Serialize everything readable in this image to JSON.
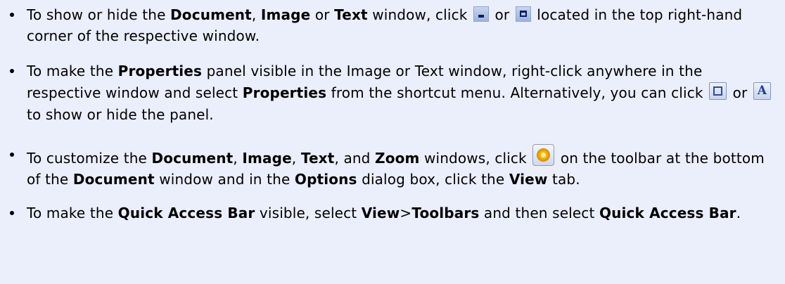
{
  "bullets": [
    {
      "t1": "To show or hide the ",
      "b1": "Document",
      "t2": ", ",
      "b2": "Image",
      "t3": " or ",
      "b3": "Text",
      "t4": " window, click ",
      "icon1": "minimize-icon",
      "t5": " or ",
      "icon2": "maximize-icon",
      "t6": " located in the top right-hand corner of the respective window."
    },
    {
      "t1": "To make the ",
      "b1": "Properties",
      "t2": " panel visible in the Image or Text window, right-click anywhere in the respective window and select ",
      "b2": "Properties",
      "t3": " from the shortcut menu. Alternatively, you can click ",
      "icon1": "image-properties-icon",
      "t4": " or ",
      "icon2": "text-properties-icon",
      "t5": " to show or hide the panel."
    },
    {
      "t1": "To customize the ",
      "b1": "Document",
      "t2": ", ",
      "b2": "Image",
      "t3": ", ",
      "b3": "Text",
      "t4": ", and ",
      "b4": "Zoom",
      "t5": " windows, click ",
      "icon1": "options-gear-icon",
      "t6": " on the toolbar at the bottom of the ",
      "b5": "Document",
      "t7": " window and in the ",
      "b6": "Options",
      "t8": " dialog box, click the ",
      "b7": "View",
      "t9": " tab."
    },
    {
      "t1": "To make the ",
      "b1": "Quick Access Bar",
      "t2": " visible, select ",
      "b2": "View",
      "t3": ">",
      "b3": "Toolbars",
      "t4": " and then select ",
      "b4": "Quick Access Bar",
      "t5": "."
    }
  ]
}
